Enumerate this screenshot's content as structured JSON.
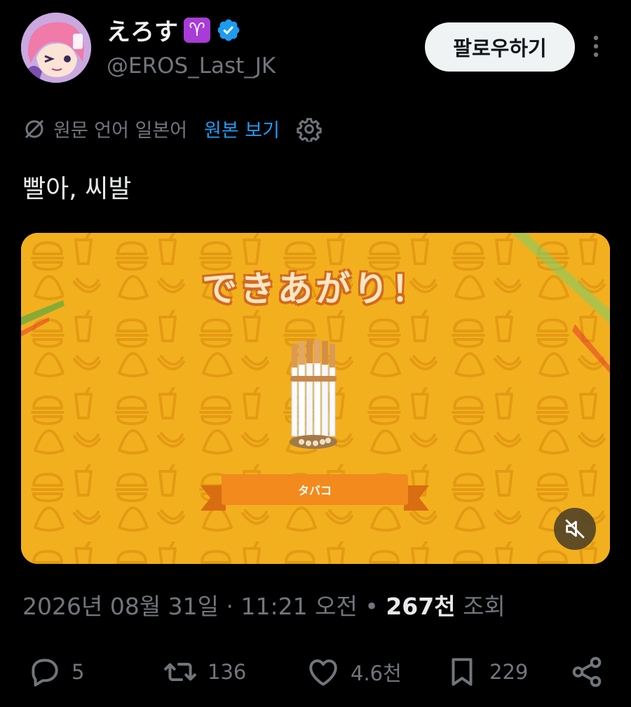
{
  "author": {
    "display_name": "えろす",
    "aries_badge": "♈",
    "handle": "@EROS_Last_JK",
    "verified_color": "#1d9bf0"
  },
  "follow_button_label": "팔로우하기",
  "translation": {
    "source_language": "원문 언어 일본어",
    "view_original": "원본 보기"
  },
  "tweet_text": "빨아, 씨발",
  "media": {
    "title": "できあがり！",
    "item_label": "タバコ",
    "background_color": "#f2b01e",
    "ribbon_color": "#f28a1e"
  },
  "meta": {
    "date": "2026년 08월 31일",
    "separator": "·",
    "time": "11:21 오전",
    "bullet": "•",
    "views_count": "267천",
    "views_label": "조회"
  },
  "actions": {
    "replies": "5",
    "reposts": "136",
    "likes": "4.6천",
    "bookmarks": "229"
  }
}
